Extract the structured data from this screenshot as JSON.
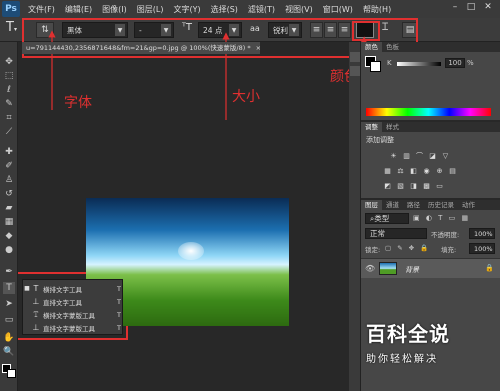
{
  "app": {
    "logo": "Ps"
  },
  "menu": [
    "文件(F)",
    "编辑(E)",
    "图像(I)",
    "图层(L)",
    "文字(Y)",
    "选择(S)",
    "滤镜(T)",
    "视图(V)",
    "窗口(W)",
    "帮助(H)"
  ],
  "window_controls": {
    "minimize": "–",
    "restore": "□",
    "close": "✕"
  },
  "options": {
    "font_family": "黑体",
    "font_style": "-",
    "font_size": "24 点",
    "aa_label": "aa",
    "antialias": "锐利",
    "text_color": "#111111"
  },
  "document": {
    "tab_title": "u=791144430,2356871648&fm=21&gp=0.jpg @ 100%(快速蒙版/8) *",
    "tab_close": "×"
  },
  "annotations": {
    "font_label": "字体",
    "size_label": "大小",
    "color_label": "颜色"
  },
  "flyout": {
    "items": [
      {
        "label": "横排文字工具",
        "key": "T",
        "selected": true
      },
      {
        "label": "直排文字工具",
        "key": "T",
        "selected": false
      },
      {
        "label": "横排文字蒙版工具",
        "key": "T",
        "selected": false
      },
      {
        "label": "直排文字蒙版工具",
        "key": "T",
        "selected": false
      }
    ]
  },
  "color_panel": {
    "tabs": [
      "颜色",
      "色板"
    ],
    "channel": "K",
    "value": "100",
    "unit": "%"
  },
  "adjustments_panel": {
    "tabs": [
      "调整",
      "样式"
    ],
    "title": "添加调整"
  },
  "layers_panel": {
    "tabs": [
      "图层",
      "通道",
      "路径",
      "历史记录",
      "动作"
    ],
    "filter_kind": "类型",
    "blend_mode": "正常",
    "opacity_label": "不透明度:",
    "opacity": "100%",
    "lock_label": "锁定:",
    "fill_label": "填充:",
    "fill": "100%",
    "layer_name": "背景"
  },
  "watermark": {
    "title": "百科全说",
    "subtitle": "助你轻松解决"
  }
}
